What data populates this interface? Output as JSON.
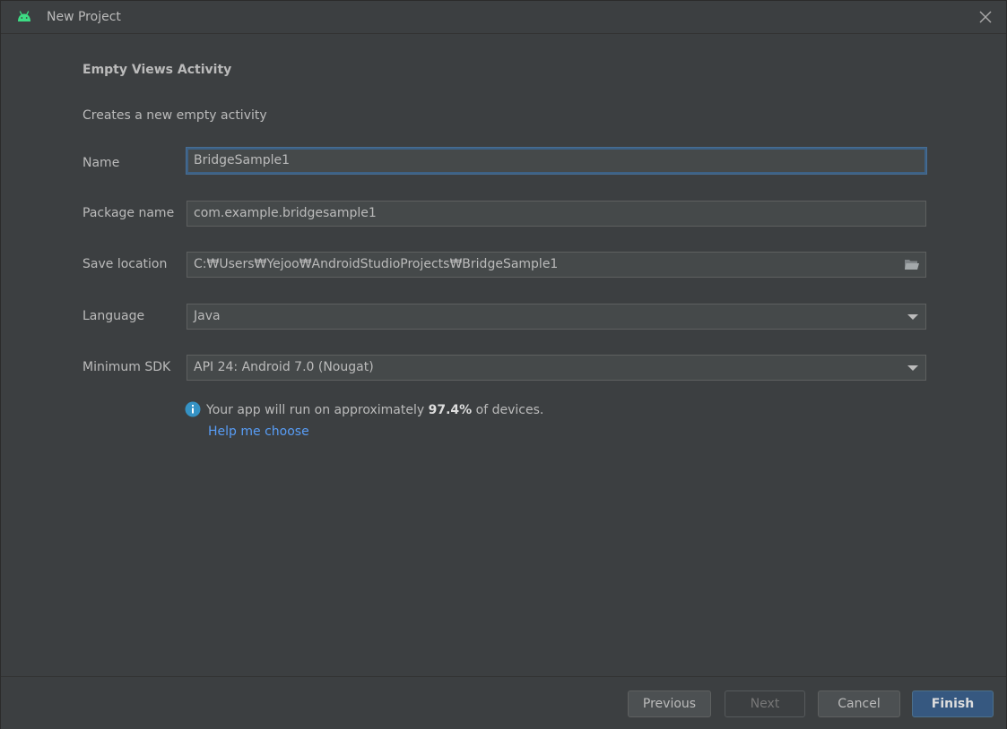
{
  "window": {
    "title": "New Project",
    "brand_color": "#3ddc84",
    "icons": {
      "app": "android-icon",
      "close": "close-icon"
    }
  },
  "template": {
    "heading": "Empty Views Activity",
    "description": "Creates a new empty activity"
  },
  "form": {
    "name": {
      "label": "Name",
      "value": "BridgeSample1"
    },
    "package": {
      "label": "Package name",
      "value": "com.example.bridgesample1"
    },
    "location": {
      "label": "Save location",
      "value": "C:₩Users₩Yejoo₩AndroidStudioProjects₩BridgeSample1",
      "icon": "folder-icon"
    },
    "language": {
      "label": "Language",
      "value": "Java"
    },
    "min_sdk": {
      "label": "Minimum SDK",
      "value": "API 24: Android 7.0 (Nougat)"
    }
  },
  "info": {
    "icon": "info-icon",
    "prefix": "Your app will run on approximately ",
    "percent": "97.4%",
    "suffix": " of devices.",
    "help_link": "Help me choose"
  },
  "buttons": {
    "previous": "Previous",
    "next": "Next",
    "cancel": "Cancel",
    "finish": "Finish"
  },
  "colors": {
    "background": "#3c3f41",
    "accent": "#365880",
    "link": "#589df6",
    "info": "#3592c4"
  }
}
